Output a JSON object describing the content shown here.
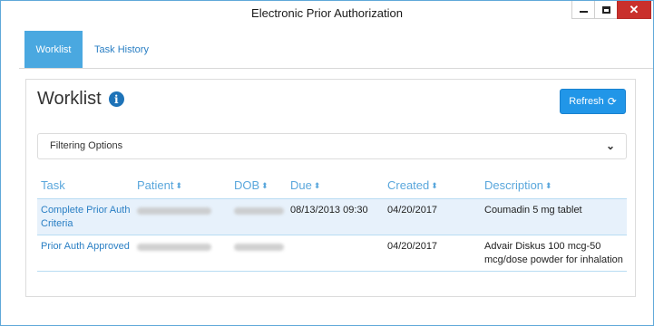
{
  "window": {
    "title": "Electronic Prior Authorization",
    "close_glyph": "✕"
  },
  "tabs": [
    {
      "label": "Worklist",
      "active": true
    },
    {
      "label": "Task History",
      "active": false
    }
  ],
  "worklist": {
    "heading": "Worklist",
    "info_glyph": "i",
    "refresh_label": "Refresh",
    "refresh_glyph": "⟳"
  },
  "filter": {
    "label": "Filtering Options",
    "chevron_glyph": "⌄"
  },
  "table": {
    "sort_glyph": "⬍",
    "headers": {
      "task": "Task",
      "patient": "Patient",
      "dob": "DOB",
      "due": "Due",
      "created": "Created",
      "description": "Description"
    },
    "rows": [
      {
        "task": "Complete Prior Auth Criteria",
        "due": "08/13/2013 09:30",
        "created": "04/20/2017",
        "description": "Coumadin 5 mg tablet"
      },
      {
        "task": "Prior Auth Approved",
        "due": "",
        "created": "04/20/2017",
        "description": "Advair Diskus 100 mcg-50 mcg/dose powder for inhalation"
      }
    ]
  },
  "colors": {
    "accent": "#2196e8",
    "tab_active": "#4aa8e0",
    "link": "#2a7fc4",
    "header_text": "#5aa7dc",
    "row_highlight": "#e7f1fb",
    "close_button": "#c9302c"
  }
}
